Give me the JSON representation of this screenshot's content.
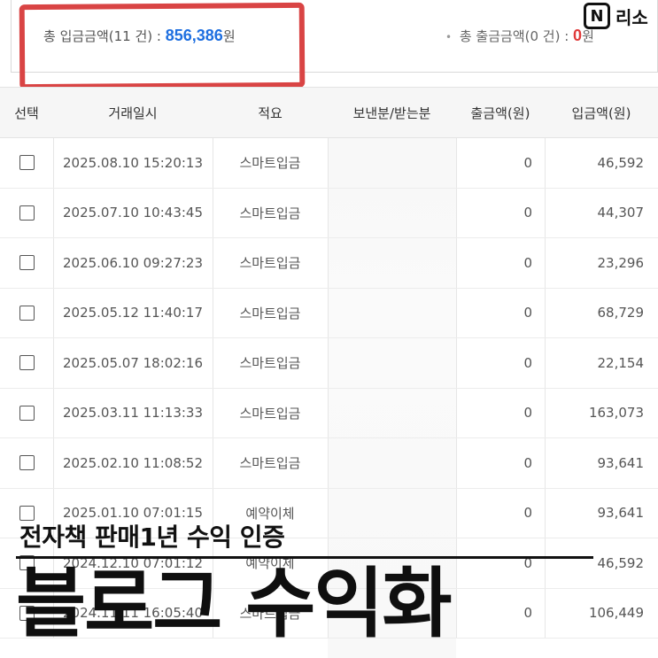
{
  "summary": {
    "deposit_label": "총 입금금액(11 건) :",
    "deposit_amount": "856,386",
    "deposit_unit": "원",
    "withdraw_label": "총 출금금액(0 건) :",
    "withdraw_amount": "0",
    "withdraw_unit": "원"
  },
  "brand": {
    "logo_letter": "N",
    "name": "리소"
  },
  "table": {
    "headers": {
      "select": "선택",
      "date": "거래일시",
      "memo": "적요",
      "party": "보낸분/받는분",
      "withdraw": "출금액(원)",
      "deposit": "입금액(원)"
    },
    "rows": [
      {
        "date": "2025.08.10 15:20:13",
        "memo": "스마트입금",
        "withdraw": "0",
        "deposit": "46,592"
      },
      {
        "date": "2025.07.10 10:43:45",
        "memo": "스마트입금",
        "withdraw": "0",
        "deposit": "44,307"
      },
      {
        "date": "2025.06.10 09:27:23",
        "memo": "스마트입금",
        "withdraw": "0",
        "deposit": "23,296"
      },
      {
        "date": "2025.05.12 11:40:17",
        "memo": "스마트입금",
        "withdraw": "0",
        "deposit": "68,729"
      },
      {
        "date": "2025.05.07 18:02:16",
        "memo": "스마트입금",
        "withdraw": "0",
        "deposit": "22,154"
      },
      {
        "date": "2025.03.11 11:13:33",
        "memo": "스마트입금",
        "withdraw": "0",
        "deposit": "163,073"
      },
      {
        "date": "2025.02.10 11:08:52",
        "memo": "스마트입금",
        "withdraw": "0",
        "deposit": "93,641"
      },
      {
        "date": "2025.01.10 07:01:15",
        "memo": "예약이체",
        "withdraw": "0",
        "deposit": "93,641"
      },
      {
        "date": "2024.12.10 07:01:12",
        "memo": "예약이체",
        "withdraw": "0",
        "deposit": "46,592"
      },
      {
        "date": "2024.11.11 16:05:40",
        "memo": "스마트입금",
        "withdraw": "0",
        "deposit": "106,449"
      }
    ]
  },
  "overlay": {
    "subtitle": "전자책 판매1년 수익 인증",
    "title": "블로그 수익화"
  },
  "colors": {
    "deposit_amount": "#1e6fe0",
    "withdraw_amount": "#e03a3a",
    "highlight_mark": "#d94444"
  }
}
